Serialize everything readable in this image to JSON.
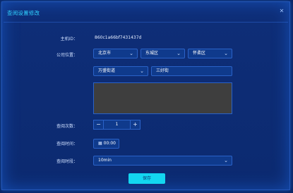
{
  "dialog": {
    "title": "查阅设置修改",
    "close_icon": "close-icon"
  },
  "labels": {
    "host_id": "主机ID：",
    "company_location": "公司位置：",
    "check_count": "查阅次数：",
    "check_time": "查阅时间：",
    "check_duration": "查阅时段："
  },
  "host_id_value": "860c1a66bf7431437d",
  "location": {
    "city": "北京市",
    "district1": "东城区",
    "district2": "怀柔区",
    "street": "万盛街道",
    "community": "三好街"
  },
  "stepper": {
    "minus": "−",
    "value": "1",
    "plus": "+"
  },
  "time_value": "00:00",
  "duration_value": "10min",
  "submit_label": "保存",
  "colors": {
    "background": "#0a2463",
    "title": "#30d2ff",
    "field_bg": "#0f3a8c",
    "field_border": "#2a62c8",
    "button": "#13d6f0",
    "textarea_bg": "#3e3e3e"
  }
}
